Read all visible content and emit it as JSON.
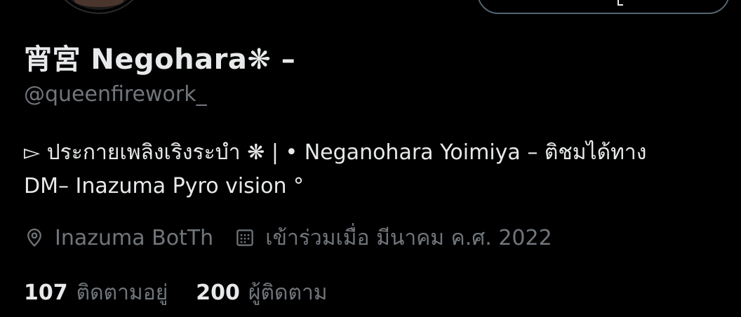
{
  "profile": {
    "display_name": "宵宮 Negohara❋ –",
    "username": "@queenfirework_",
    "bio": {
      "line1": "▻ ประกายเพลิงเริงระบำ ❋ | • Neganohara Yoimiya – ติชมได้ทาง",
      "line2": "DM– Inazuma Pyro vision °"
    },
    "location": "Inazuma BotTh",
    "joined": "เข้าร่วมเมื่อ มีนาคม ค.ศ. 2022"
  },
  "stats": {
    "following_count": "107",
    "following_label": "ติดตามอยู่",
    "followers_count": "200",
    "followers_label": "ผู้ติดตาม"
  },
  "colors": {
    "background": "#000000",
    "primary_text": "#e7e9ea",
    "secondary_text": "#71767b",
    "border": "#536471"
  },
  "icons": {
    "location": "map-pin-icon",
    "joined": "calendar-icon"
  }
}
